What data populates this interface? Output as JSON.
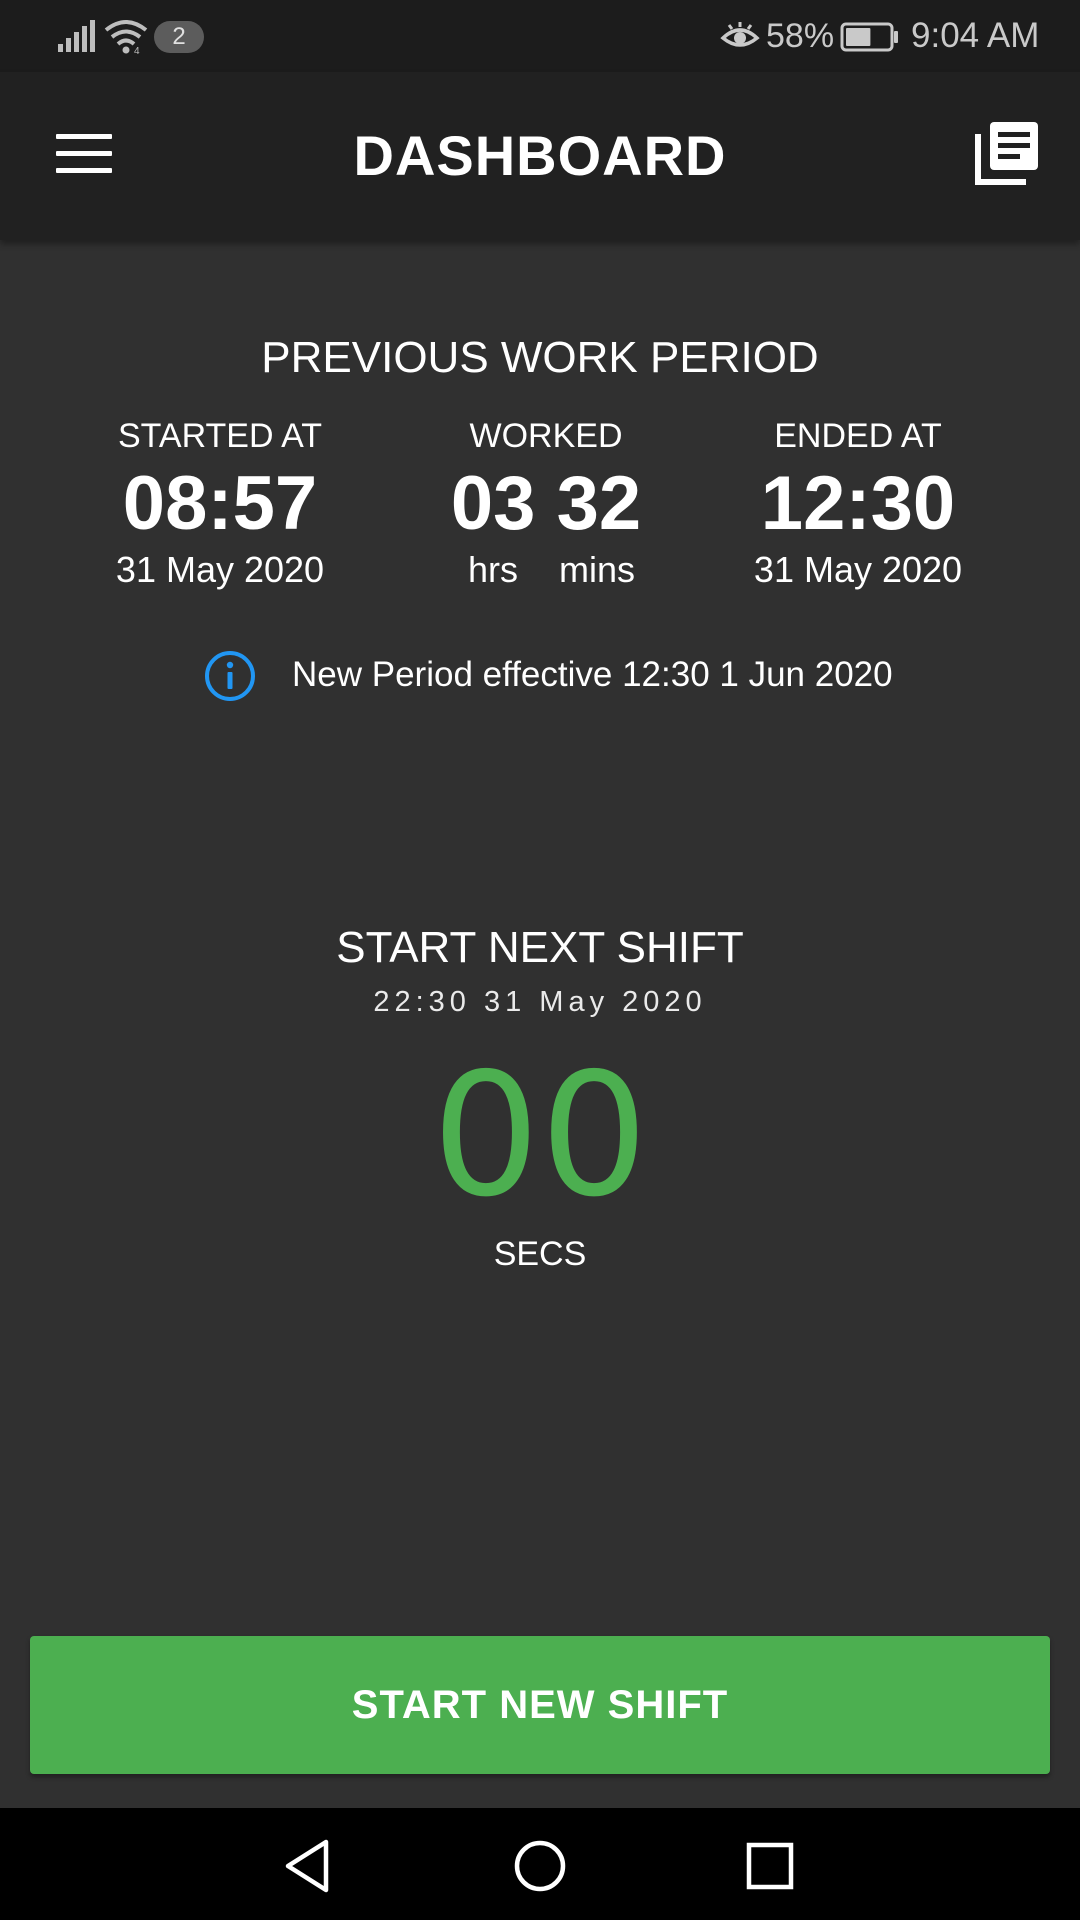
{
  "status_bar": {
    "notification_count": "2",
    "battery_percent": "58%",
    "battery_level": 0.58,
    "time": "9:04 AM",
    "icons": [
      "signal-icon",
      "wifi-icon",
      "eye-comfort-icon",
      "battery-icon"
    ]
  },
  "app_bar": {
    "title": "DASHBOARD",
    "left_icon": "menu-icon",
    "right_icon": "library-books-icon"
  },
  "previous_period": {
    "title": "PREVIOUS WORK PERIOD",
    "started": {
      "label": "STARTED AT",
      "time": "08:57",
      "date": "31 May 2020"
    },
    "worked": {
      "label": "WORKED",
      "hours": "03",
      "minutes": "32",
      "hours_unit": "hrs",
      "minutes_unit": "mins"
    },
    "ended": {
      "label": "ENDED AT",
      "time": "12:30",
      "date": "31 May 2020"
    },
    "info": {
      "icon": "info-icon",
      "text": "New Period effective 12:30 1 Jun 2020"
    }
  },
  "next_shift": {
    "title": "START NEXT SHIFT",
    "datetime": "22:30 31 May 2020",
    "countdown_value": "00",
    "countdown_unit": "SECS"
  },
  "actions": {
    "start_new_shift_label": "START NEW SHIFT"
  },
  "nav_bar": {
    "icons": [
      "back-icon",
      "home-icon",
      "recents-icon"
    ]
  },
  "colors": {
    "background": "#303030",
    "app_bar": "#212121",
    "status_bar": "#1c1c1c",
    "accent_green": "#4caf50",
    "info_blue": "#2196f3",
    "nav_bar": "#000000"
  }
}
